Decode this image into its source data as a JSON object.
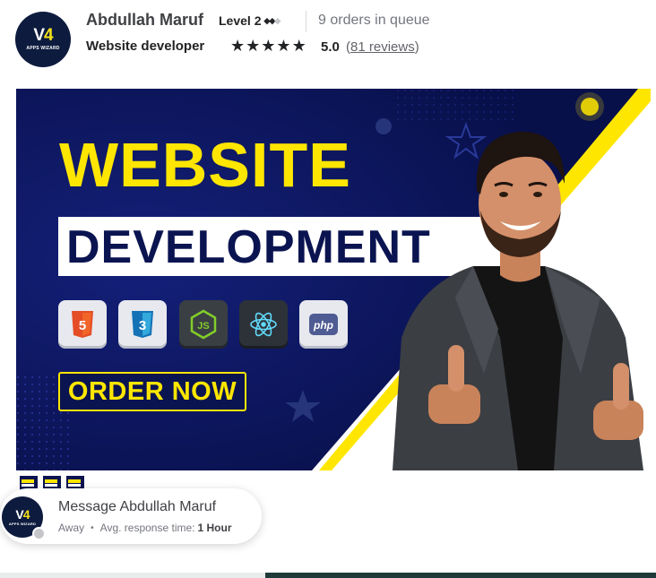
{
  "seller": {
    "name": "Abdullah Maruf",
    "level": "Level 2",
    "level_filled": "◆◆",
    "level_empty": "◆",
    "queue": "9 orders in queue",
    "title": "Website developer",
    "rating": "5.0",
    "reviews_open": "(",
    "reviews_link": "81 reviews",
    "reviews_close": ")",
    "stars": 5,
    "logo_mark": "V",
    "logo_accent": "4",
    "logo_text": "APPS WIZARD"
  },
  "banner": {
    "title": "WEBSITE",
    "subtitle": "DEVELOPMENT",
    "cta": "ORDER NOW",
    "tech_icons": [
      "html5-icon",
      "css3-icon",
      "nodejs-icon",
      "react-icon",
      "php-icon"
    ],
    "php_label": "php",
    "colors": {
      "background": "#0a1450",
      "accent": "#ffe600",
      "stripe": "#ffe600"
    }
  },
  "message": {
    "title": "Message Abdullah Maruf",
    "status": "Away",
    "separator": "•",
    "response_label": "Avg. response time:",
    "response_value": "1 Hour"
  }
}
